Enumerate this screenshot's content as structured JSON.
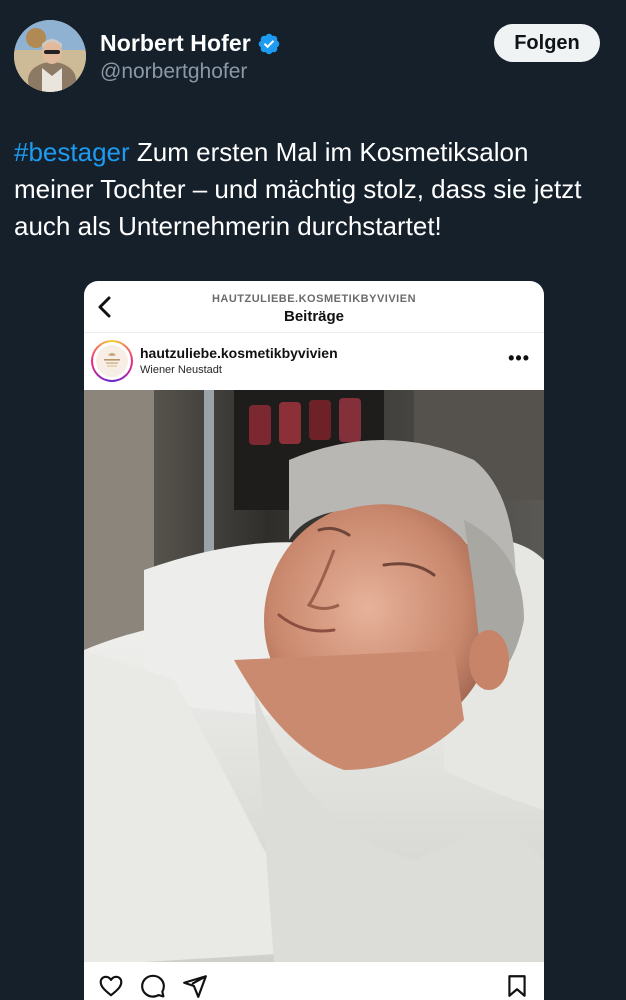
{
  "author": {
    "display_name": "Norbert Hofer",
    "handle": "@norbertghofer",
    "verified": true,
    "verified_color": "#1d9bf0"
  },
  "follow_button": {
    "label": "Folgen"
  },
  "tweet": {
    "hashtag": "#bestager",
    "text": " Zum ersten Mal im Kosmetiksalon meiner Tochter – und mächtig stolz, dass sie jetzt auch als Unternehmerin durchstartet!"
  },
  "embedded_post": {
    "header_account": "HAUTZULIEBE.KOSMETIKBYVIVIEN",
    "header_title": "Beiträge",
    "username": "hautzuliebe.kosmetikbyvivien",
    "location": "Wiener Neustadt",
    "more_icon": "more-horizontal-icon",
    "actions": [
      "heart-icon",
      "comment-icon",
      "share-icon",
      "bookmark-icon"
    ]
  },
  "colors": {
    "background": "#15202b",
    "link": "#1d9bf0",
    "secondary_text": "#8b98a5"
  }
}
